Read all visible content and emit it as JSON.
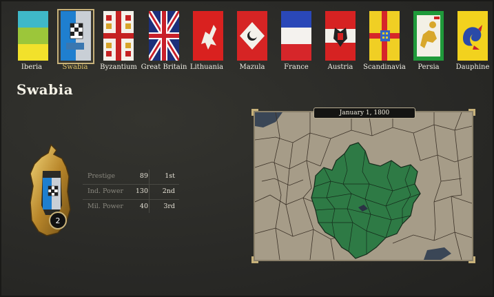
{
  "nations": [
    {
      "name": "Iberia",
      "selected": false
    },
    {
      "name": "Swabia",
      "selected": true
    },
    {
      "name": "Byzantium",
      "selected": false
    },
    {
      "name": "Great Britain",
      "selected": false
    },
    {
      "name": "Lithuania",
      "selected": false
    },
    {
      "name": "Mazula",
      "selected": false
    },
    {
      "name": "France",
      "selected": false
    },
    {
      "name": "Austria",
      "selected": false
    },
    {
      "name": "Scandinavia",
      "selected": false
    },
    {
      "name": "Persia",
      "selected": false
    },
    {
      "name": "Dauphine",
      "selected": false
    }
  ],
  "selected_nation": {
    "title": "Swabia",
    "crest_badge": "2"
  },
  "stats": [
    {
      "label": "Prestige",
      "value": "89",
      "rank": "1st"
    },
    {
      "label": "Ind. Power",
      "value": "130",
      "rank": "2nd"
    },
    {
      "label": "Mil. Power",
      "value": "40",
      "rank": "3rd"
    }
  ],
  "map": {
    "date": "January 1, 1800"
  },
  "colors": {
    "background": "#2b2b29",
    "selected_border": "#c8b27a",
    "map_land": "#a69c88",
    "map_owned": "#2e7a45",
    "map_sea": "#3a4656"
  }
}
